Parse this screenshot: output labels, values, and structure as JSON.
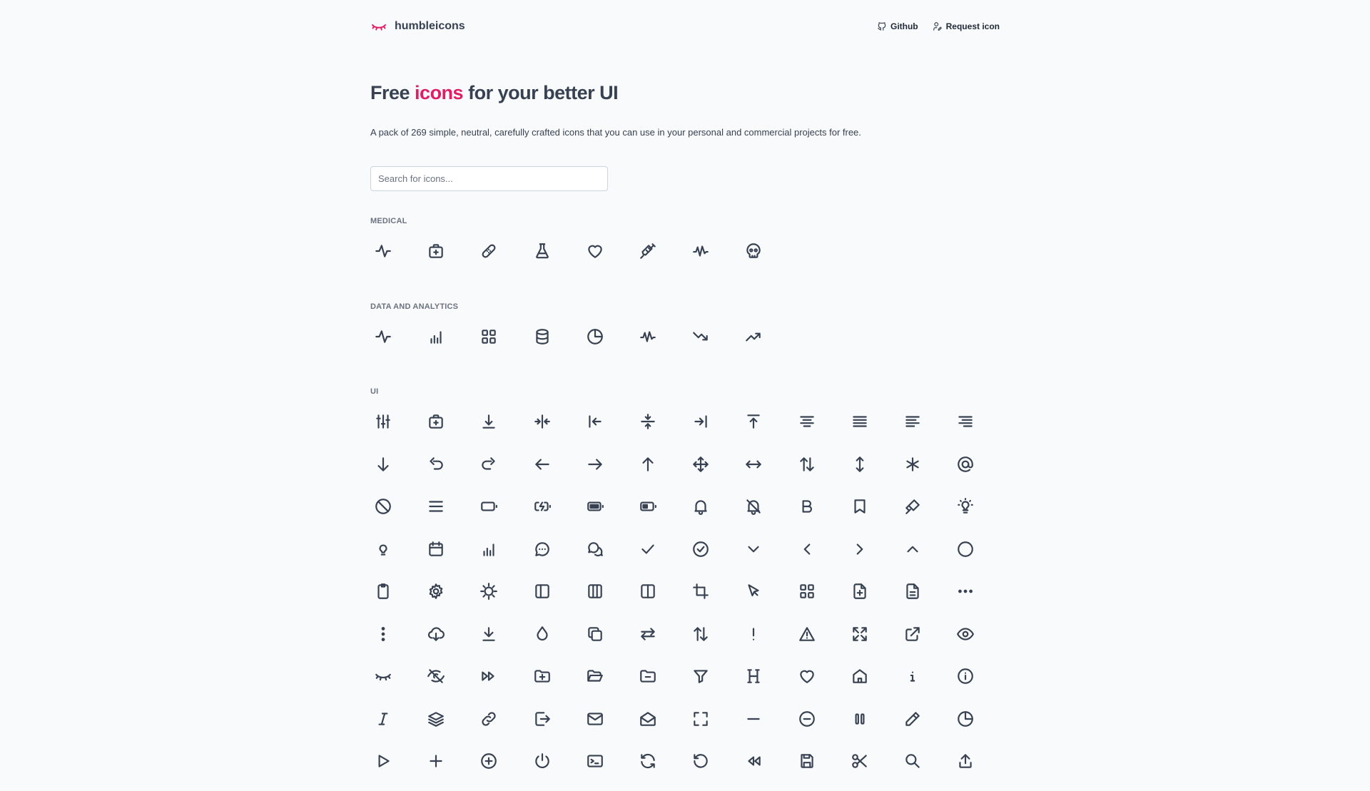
{
  "brand": {
    "name": "humbleicons",
    "logo_icon": "eye-closed-icon",
    "accent": "#e11d63"
  },
  "nav": [
    {
      "label": "Github",
      "icon": "github-icon"
    },
    {
      "label": "Request icon",
      "icon": "user-edit-icon"
    }
  ],
  "hero": {
    "title_before": "Free ",
    "title_accent": "icons",
    "title_after": " for your better UI",
    "description": "A pack of 269 simple, neutral, carefully crafted icons that you can use in your personal and commercial projects for free."
  },
  "search": {
    "placeholder": "Search for icons...",
    "value": ""
  },
  "categories": [
    {
      "title": "MEDICAL",
      "icons": [
        "activity",
        "first-aid",
        "bandage",
        "flask",
        "heart",
        "syringe",
        "pulse",
        "skull"
      ]
    },
    {
      "title": "DATA AND ANALYTICS",
      "icons": [
        "activity",
        "bar-chart",
        "dashboard",
        "database",
        "pie-chart",
        "pulse",
        "trending-down",
        "trending-up"
      ]
    },
    {
      "title": "UI",
      "icons": [
        "adjustments",
        "first-aid",
        "align-bottom",
        "align-center-vertical",
        "align-left",
        "align-center-horizontal",
        "align-right",
        "align-top",
        "text-center",
        "text-justify",
        "text-left",
        "text-right",
        "arrow-down",
        "undo",
        "redo",
        "arrow-left",
        "arrow-right",
        "arrow-up",
        "move",
        "arrows-horizontal",
        "arrows-up-down",
        "arrows-vertical",
        "asterisk",
        "at-symbol",
        "ban",
        "bars",
        "battery-empty",
        "battery-charging",
        "battery-full",
        "battery-half",
        "bell",
        "bell-off",
        "bold",
        "bookmark",
        "brush",
        "bulb-on",
        "bulb",
        "calendar",
        "bar-chart",
        "chat",
        "chats",
        "check",
        "check-circle",
        "chevron-down",
        "chevron-left",
        "chevron-right",
        "chevron-up",
        "circle",
        "clipboard",
        "cog",
        "cog-alt",
        "columns-left",
        "columns-three",
        "columns-two",
        "crop",
        "cursor",
        "dashboard",
        "document-add",
        "document",
        "dots-horizontal",
        "dots-vertical",
        "cloud-download",
        "download",
        "drop",
        "duplicate",
        "exchange-horizontal",
        "exchange-vertical",
        "exclamation",
        "warning",
        "expand",
        "external-link",
        "eye",
        "eye-closed",
        "eye-off",
        "fast-forward",
        "folder-add",
        "folder-open",
        "folder-remove",
        "filter",
        "heading",
        "heart",
        "home",
        "info",
        "info-circle",
        "italic",
        "layers",
        "link",
        "logout",
        "mail",
        "mail-open",
        "maximize",
        "minus",
        "minus-circle",
        "pause",
        "pencil",
        "pie-chart",
        "play",
        "plus",
        "plus-circle",
        "power",
        "terminal",
        "refresh",
        "rotate-ccw",
        "rewind",
        "save",
        "scissors",
        "search",
        "upload"
      ]
    }
  ]
}
